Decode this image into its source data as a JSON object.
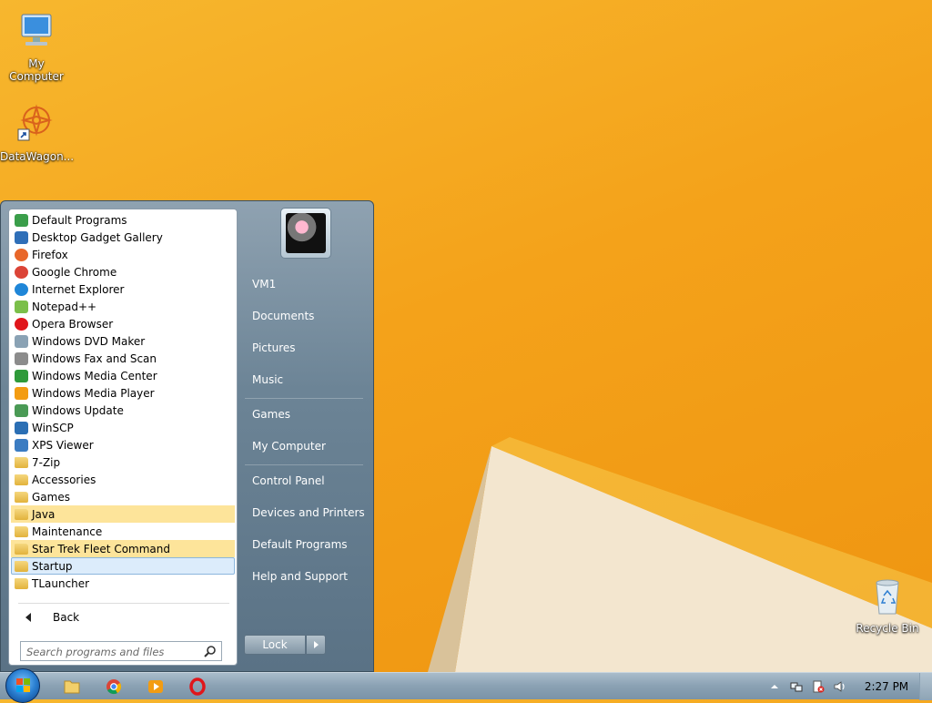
{
  "desktop": {
    "icons": [
      {
        "label": "My Computer",
        "icon": "computer-icon"
      },
      {
        "label": "DataWagon...",
        "icon": "datawagon-shortcut-icon"
      },
      {
        "label": "Recycle Bin",
        "icon": "recycle-bin-icon"
      }
    ]
  },
  "start_menu": {
    "programs": [
      {
        "label": "Default Programs",
        "icon": "default-programs-icon"
      },
      {
        "label": "Desktop Gadget Gallery",
        "icon": "gadget-gallery-icon"
      },
      {
        "label": "Firefox",
        "icon": "firefox-icon"
      },
      {
        "label": "Google Chrome",
        "icon": "chrome-icon"
      },
      {
        "label": "Internet Explorer",
        "icon": "internet-explorer-icon"
      },
      {
        "label": "Notepad++",
        "icon": "notepad-plus-plus-icon"
      },
      {
        "label": "Opera Browser",
        "icon": "opera-icon"
      },
      {
        "label": "Windows DVD Maker",
        "icon": "dvd-maker-icon"
      },
      {
        "label": "Windows Fax and Scan",
        "icon": "fax-scan-icon"
      },
      {
        "label": "Windows Media Center",
        "icon": "media-center-icon"
      },
      {
        "label": "Windows Media Player",
        "icon": "media-player-icon"
      },
      {
        "label": "Windows Update",
        "icon": "windows-update-icon"
      },
      {
        "label": "WinSCP",
        "icon": "winscp-icon"
      },
      {
        "label": "XPS Viewer",
        "icon": "xps-viewer-icon"
      },
      {
        "label": "7-Zip",
        "icon": "folder-icon"
      },
      {
        "label": "Accessories",
        "icon": "folder-icon"
      },
      {
        "label": "Games",
        "icon": "folder-icon"
      },
      {
        "label": "Java",
        "icon": "folder-icon"
      },
      {
        "label": "Maintenance",
        "icon": "folder-icon"
      },
      {
        "label": "Star Trek Fleet Command",
        "icon": "folder-icon"
      },
      {
        "label": "Startup",
        "icon": "folder-icon"
      },
      {
        "label": "TLauncher",
        "icon": "folder-icon"
      }
    ],
    "back_label": "Back",
    "search_placeholder": "Search programs and files",
    "right_items": [
      "VM1",
      "Documents",
      "Pictures",
      "Music",
      "Games",
      "My Computer",
      "Control Panel",
      "Devices and Printers",
      "Default Programs",
      "Help and Support"
    ],
    "lock_label": "Lock"
  },
  "taskbar": {
    "pinned": [
      {
        "name": "file-explorer",
        "icon": "folder-icon"
      },
      {
        "name": "chrome",
        "icon": "chrome-icon"
      },
      {
        "name": "media-player",
        "icon": "media-player-icon"
      },
      {
        "name": "opera",
        "icon": "opera-icon"
      }
    ],
    "clock": "2:27 PM"
  },
  "colors": {
    "wallpaper": "#f4a21a",
    "highlight": "#fde49a",
    "selected": "#dcecfb"
  }
}
